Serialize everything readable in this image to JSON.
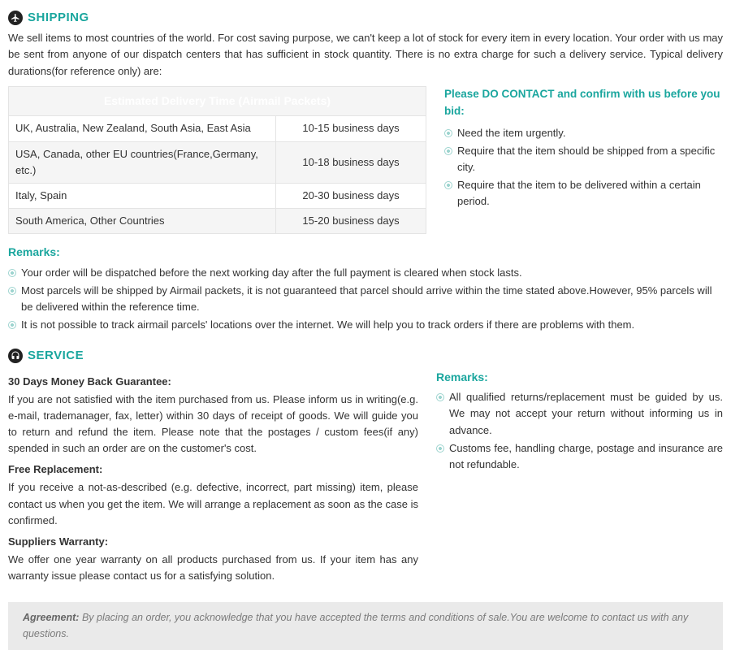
{
  "shipping": {
    "title": "SHIPPING",
    "intro": "We sell items to most countries of the world. For cost saving purpose, we can't keep a lot of stock for every item in every location. Your order with us may be sent from anyone of our dispatch centers that has sufficient in stock quantity. There is no extra charge for such a delivery service. Typical delivery durations(for reference only) are:",
    "table_title": "Estimated Delivery Time (Airmail Packets)",
    "rows": [
      {
        "region": "UK, Australia, New Zealand, South Asia, East Asia",
        "duration": "10-15 business days"
      },
      {
        "region": "USA, Canada, other EU countries(France,Germany, etc.)",
        "duration": "10-18 business days"
      },
      {
        "region": "Italy, Spain",
        "duration": "20-30 business days"
      },
      {
        "region": "South America, Other Countries",
        "duration": "15-20 business days"
      }
    ],
    "contact_head": "Please DO CONTACT and confirm with us before you bid:",
    "contact_items": [
      "Need the item urgently.",
      "Require that the item should be shipped from a specific city.",
      "Require that the item to be delivered within a certain period."
    ],
    "remarks_title": "Remarks:",
    "remarks": [
      "Your order will be dispatched before the next working day after the full payment is cleared when stock lasts.",
      "Most parcels will be shipped by Airmail packets, it is not guaranteed that parcel should arrive within the time stated above.However, 95% parcels will be delivered within the reference time.",
      "It is not possible to track airmail parcels' locations over the internet. We will help you to track orders if there are problems with them."
    ]
  },
  "service": {
    "title": "SERVICE",
    "blocks": [
      {
        "head": "30 Days Money Back Guarantee:",
        "body": "If you are not satisfied with the item purchased from us. Please inform us in writing(e.g. e-mail, trademanager, fax, letter) within 30 days of receipt of goods. We will guide you to return and refund the item. Please note that the postages / custom fees(if any) spended in such an order are on the customer's cost."
      },
      {
        "head": "Free Replacement:",
        "body": "If you receive a not-as-described (e.g. defective, incorrect, part missing) item, please contact us when you get the item. We will arrange a replacement as soon as the case is confirmed."
      },
      {
        "head": "Suppliers Warranty:",
        "body": "We offer one year warranty on all products purchased from us. If your item has any warranty issue please contact us for a satisfying solution."
      }
    ],
    "remarks_title": "Remarks:",
    "remarks": [
      "All qualified returns/replacement must be guided by us. We may not accept your return without informing us in advance.",
      "Customs fee, handling charge, postage and insurance are not refundable."
    ]
  },
  "footer": {
    "label": "Agreement:",
    "text": " By placing an order, you acknowledge that you have accepted the terms and conditions of sale.You are welcome to contact us with any questions."
  }
}
